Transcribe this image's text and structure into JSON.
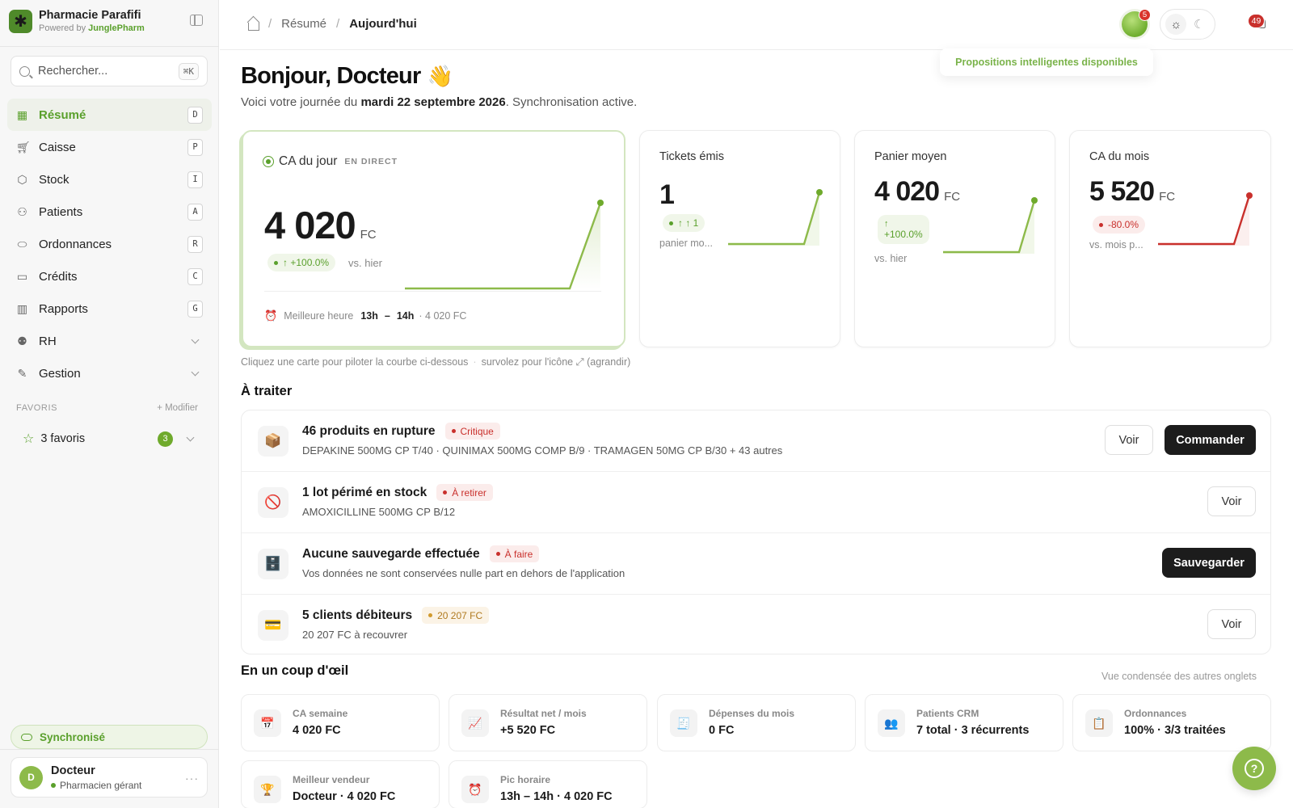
{
  "app": {
    "name": "Pharmacie Parafifi",
    "powered_prefix": "Powered by",
    "powered_brand": "JunglePharm"
  },
  "search": {
    "placeholder": "Rechercher...",
    "shortcut": "⌘K"
  },
  "nav": [
    {
      "label": "Résumé",
      "key": "D",
      "icon": "grid-icon",
      "active": true
    },
    {
      "label": "Caisse",
      "key": "P",
      "icon": "cart-icon"
    },
    {
      "label": "Stock",
      "key": "I",
      "icon": "box-icon"
    },
    {
      "label": "Patients",
      "key": "A",
      "icon": "person-icon"
    },
    {
      "label": "Ordonnances",
      "key": "R",
      "icon": "pill-icon"
    },
    {
      "label": "Crédits",
      "key": "C",
      "icon": "wallet-icon"
    },
    {
      "label": "Rapports",
      "key": "G",
      "icon": "bar-chart-icon"
    },
    {
      "label": "RH",
      "icon": "people-icon",
      "expandable": true
    },
    {
      "label": "Gestion",
      "icon": "tools-icon",
      "expandable": true
    }
  ],
  "favorites": {
    "heading": "FAVORIS",
    "modify": "+ Modifier",
    "label": "3 favoris",
    "count": "3"
  },
  "sync": {
    "label": "Synchronisé"
  },
  "user": {
    "name": "Docteur",
    "initial": "D",
    "role": "Pharmacien gérant"
  },
  "breadcrumb": {
    "parent": "Résumé",
    "current": "Aujourd'hui"
  },
  "topbar": {
    "orb_badge": "5",
    "notif_count": "49",
    "propositions": "Propositions intelligentes disponibles"
  },
  "greeting": {
    "title": "Bonjour, Docteur",
    "emoji": "👋",
    "subtitle_prefix": "Voici votre journée du",
    "date": "mardi 22 septembre 2026",
    "subtitle_suffix": ". Synchronisation active."
  },
  "kpis": {
    "ca_jour": {
      "title": "CA du jour",
      "tag": "EN DIRECT",
      "value": "4 020",
      "unit": "FC",
      "delta": "↑ +100.0%",
      "compare": "vs. hier",
      "best_label": "Meilleure heure",
      "best_from": "13h",
      "best_dash": "–",
      "best_to": "14h",
      "best_amount": "· 4 020 FC"
    },
    "tickets": {
      "title": "Tickets émis",
      "value": "1",
      "delta": "↑ ↑ 1",
      "compare": "panier mo..."
    },
    "panier": {
      "title": "Panier moyen",
      "value": "4 020",
      "unit": "FC",
      "delta_arrow": "↑",
      "delta": "+100.0%",
      "compare": "vs. hier"
    },
    "ca_mois": {
      "title": "CA du mois",
      "value": "5 520",
      "unit": "FC",
      "delta": "-80.0%",
      "compare": "vs. mois p..."
    }
  },
  "hint": {
    "left": "Cliquez une carte pour piloter la courbe ci-dessous",
    "right": "survolez pour l'icône ⤢ (agrandir)"
  },
  "todo": {
    "heading": "À traiter",
    "items": [
      {
        "icon": "package-icon",
        "glyph": "📦",
        "title": "46 produits en rupture",
        "tag": "Critique",
        "tag_tone": "red",
        "sub": "DEPAKINE 500MG CP T/40 · QUINIMAX 500MG COMP B/9 · TRAMAGEN 50MG CP B/30 + 43 autres",
        "voir": "Voir",
        "action": "Commander"
      },
      {
        "icon": "prohibited-icon",
        "glyph": "🚫",
        "title": "1 lot périmé en stock",
        "tag": "À retirer",
        "tag_tone": "red",
        "sub": "AMOXICILLINE 500MG CP B/12",
        "voir": "Voir"
      },
      {
        "icon": "database-icon",
        "glyph": "🗄️",
        "title": "Aucune sauvegarde effectuée",
        "tag": "À faire",
        "tag_tone": "red",
        "sub": "Vos données ne sont conservées nulle part en dehors de l'application",
        "action": "Sauvegarder"
      },
      {
        "icon": "credit-card-icon",
        "glyph": "💳",
        "title": "5 clients débiteurs",
        "tag": "20 207 FC",
        "tag_tone": "amber",
        "sub": "20 207 FC à recouvrer",
        "voir": "Voir"
      }
    ]
  },
  "glance": {
    "heading": "En un coup d'œil",
    "note": "Vue condensée des autres onglets",
    "tiles": [
      {
        "icon": "calendar-icon",
        "glyph": "📅",
        "label": "CA semaine",
        "value": "4 020 FC"
      },
      {
        "icon": "trend-icon",
        "glyph": "📈",
        "label": "Résultat net / mois",
        "value": "+5 520 FC"
      },
      {
        "icon": "receipt-icon",
        "glyph": "🧾",
        "label": "Dépenses du mois",
        "value": "0 FC"
      },
      {
        "icon": "people-icon",
        "glyph": "👥",
        "label": "Patients CRM",
        "value": "7 total · 3 récurrents"
      },
      {
        "icon": "clipboard-icon",
        "glyph": "📋",
        "label": "Ordonnances",
        "value": "100% · 3/3 traitées"
      },
      {
        "icon": "trophy-icon",
        "glyph": "🏆",
        "label": "Meilleur vendeur",
        "value": "Docteur · 4 020 FC"
      },
      {
        "icon": "alarm-icon",
        "glyph": "⏰",
        "label": "Pic horaire",
        "value": "13h – 14h · 4 020 FC"
      }
    ]
  },
  "colors": {
    "accent": "#5aa02c",
    "danger": "#c9302c",
    "dark_button": "#1c1c1c"
  }
}
